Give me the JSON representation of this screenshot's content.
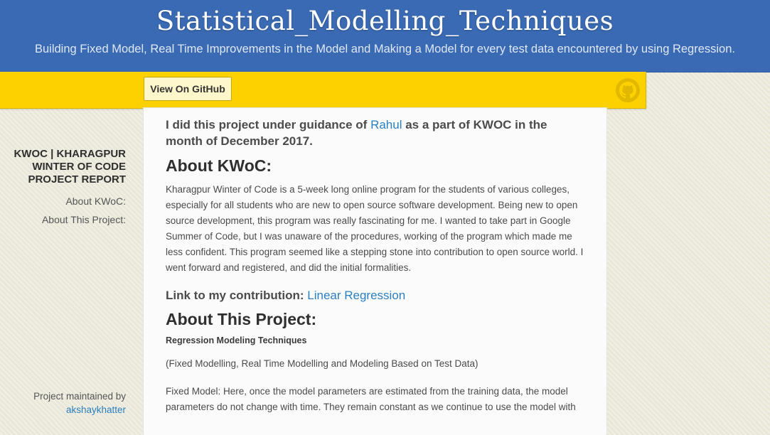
{
  "header": {
    "title": "Statistical_Modelling_Techniques",
    "subtitle": "Building Fixed Model, Real Time Improvements in the Model and Making a Model for every test data encountered by using Regression."
  },
  "toolbar": {
    "github_button": "View On GitHub",
    "github_icon": "github-octocat-icon"
  },
  "sidebar": {
    "title": "KWOC | KHARAGPUR WINTER OF CODE PROJECT REPORT",
    "links": [
      "About KWoC:",
      "About This Project:"
    ],
    "maintained_by": "Project maintained by",
    "maintainer": "akshaykhatter"
  },
  "content": {
    "intro_before": "I did this project under guidance of ",
    "intro_link": "Rahul",
    "intro_after": " as a part of KWOC in the month of December 2017.",
    "about_kwoc_heading": "About KWoC:",
    "about_kwoc_text": "Kharagpur Winter of Code is a 5-week long online program for the students of various colleges, especially for all students who are new to open source software development. Being new to open source development, this program was really fascinating for me. I wanted to take part in Google Summer of Code, but I was unaware of the procedures, working of the program which made me less confident. This program seemed like a stepping stone into contribution to open source world. I went forward and registered, and did the initial formalities.",
    "contribution_label": "Link to my contribution: ",
    "contribution_link": "Linear Regression",
    "about_project_heading": "About This Project:",
    "project_subhead": "Regression Modeling Techniques",
    "project_types": "(Fixed Modelling, Real Time Modelling and Modeling Based on Test Data)",
    "fixed_model_text": "Fixed Model: Here, once the model parameters are estimated from the training data, the model parameters do not change with time. They remain constant as we continue to use the model with"
  },
  "colors": {
    "header_bg": "#3a6ab3",
    "toolbar_bg": "#fdd100",
    "link": "#2a7fc0"
  }
}
